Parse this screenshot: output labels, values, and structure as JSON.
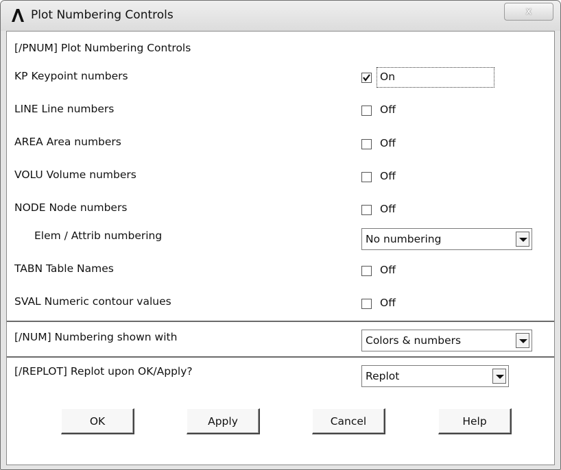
{
  "window": {
    "title": "Plot Numbering Controls",
    "close_glyph": "x"
  },
  "section_pnum": {
    "header": "[/PNUM]  Plot Numbering Controls"
  },
  "options": [
    {
      "label": "KP    Keypoint numbers",
      "checked": true,
      "state": "On"
    },
    {
      "label": "LINE  Line numbers",
      "checked": false,
      "state": "Off"
    },
    {
      "label": "AREA  Area numbers",
      "checked": false,
      "state": "Off"
    },
    {
      "label": "VOLU  Volume numbers",
      "checked": false,
      "state": "Off"
    },
    {
      "label": "NODE  Node numbers",
      "checked": false,
      "state": "Off"
    }
  ],
  "elem_attrib": {
    "label": "Elem / Attrib numbering",
    "value": "No numbering"
  },
  "options2": [
    {
      "label": "TABN  Table Names",
      "checked": false,
      "state": "Off"
    },
    {
      "label": "SVAL  Numeric contour values",
      "checked": false,
      "state": "Off"
    }
  ],
  "num": {
    "label": "[/NUM]  Numbering shown with",
    "value": "Colors & numbers"
  },
  "replot": {
    "label": "[/REPLOT] Replot upon OK/Apply?",
    "value": "Replot"
  },
  "buttons": {
    "ok": "OK",
    "apply": "Apply",
    "cancel": "Cancel",
    "help": "Help"
  },
  "icons": {
    "app": "ansys-logo-icon",
    "close": "close-icon",
    "check": "check-icon",
    "dropdown": "chevron-down-icon"
  }
}
